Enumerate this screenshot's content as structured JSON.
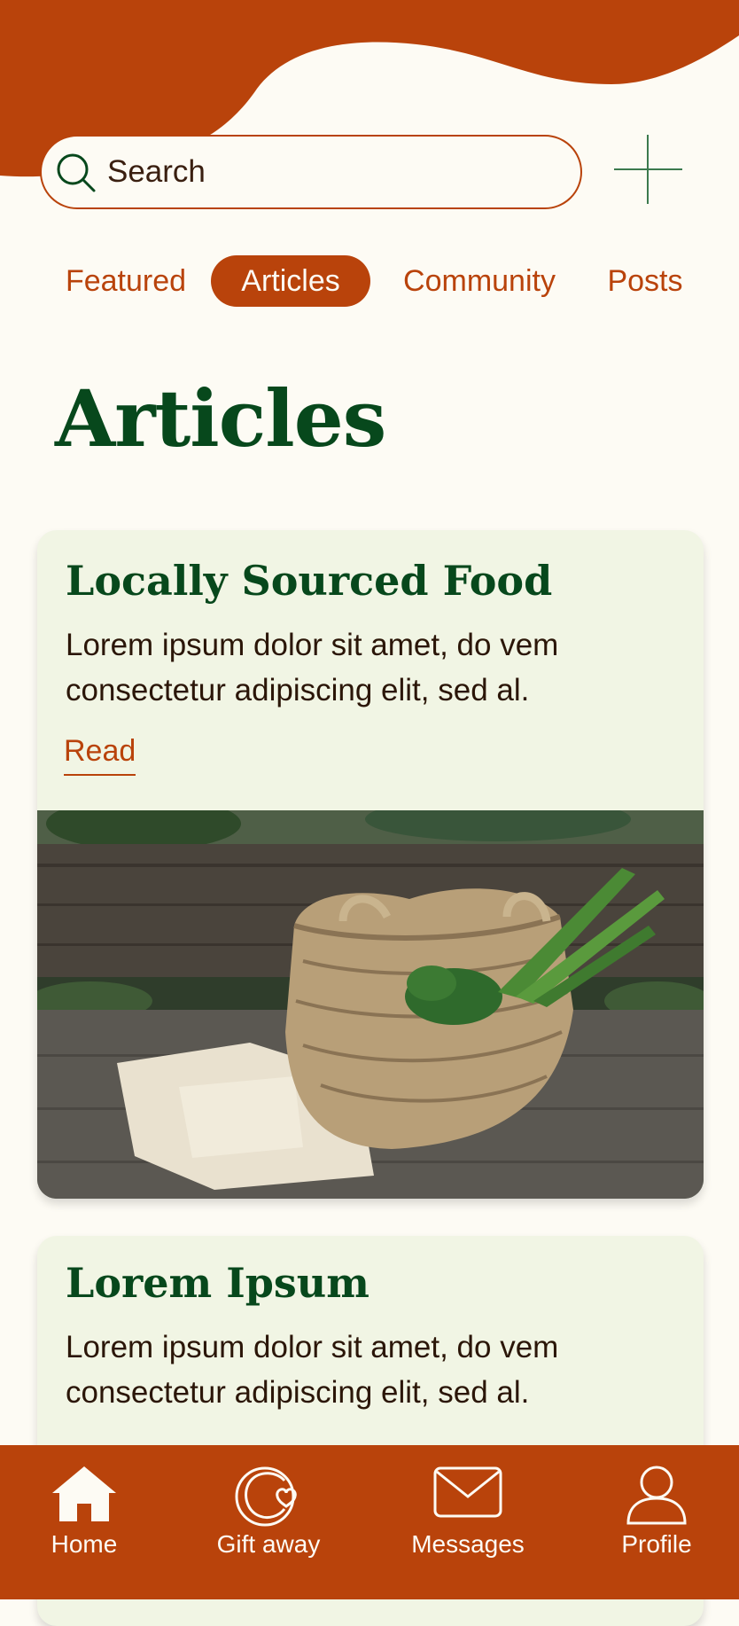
{
  "search": {
    "placeholder": "Search"
  },
  "tabs": [
    {
      "label": "Featured",
      "active": false
    },
    {
      "label": "Articles",
      "active": true
    },
    {
      "label": "Community",
      "active": false
    },
    {
      "label": "Posts",
      "active": false
    }
  ],
  "page": {
    "title": "Articles"
  },
  "articles": [
    {
      "title": "Locally Sourced Food",
      "body": "Lorem ipsum dolor sit amet, do vem consectetur adipiscing elit, sed al.",
      "read_label": "Read"
    },
    {
      "title": "Lorem Ipsum",
      "body": "Lorem ipsum dolor sit amet, do vem consectetur adipiscing elit, sed al."
    }
  ],
  "nav": [
    {
      "label": "Home",
      "icon": "home-icon"
    },
    {
      "label": "Gift away",
      "icon": "gift-away-icon"
    },
    {
      "label": "Messages",
      "icon": "envelope-icon"
    },
    {
      "label": "Profile",
      "icon": "user-icon"
    }
  ],
  "colors": {
    "accent": "#b9430b",
    "title_green": "#07481c",
    "background": "#fdfbf4",
    "card": "#f1f5e4"
  }
}
